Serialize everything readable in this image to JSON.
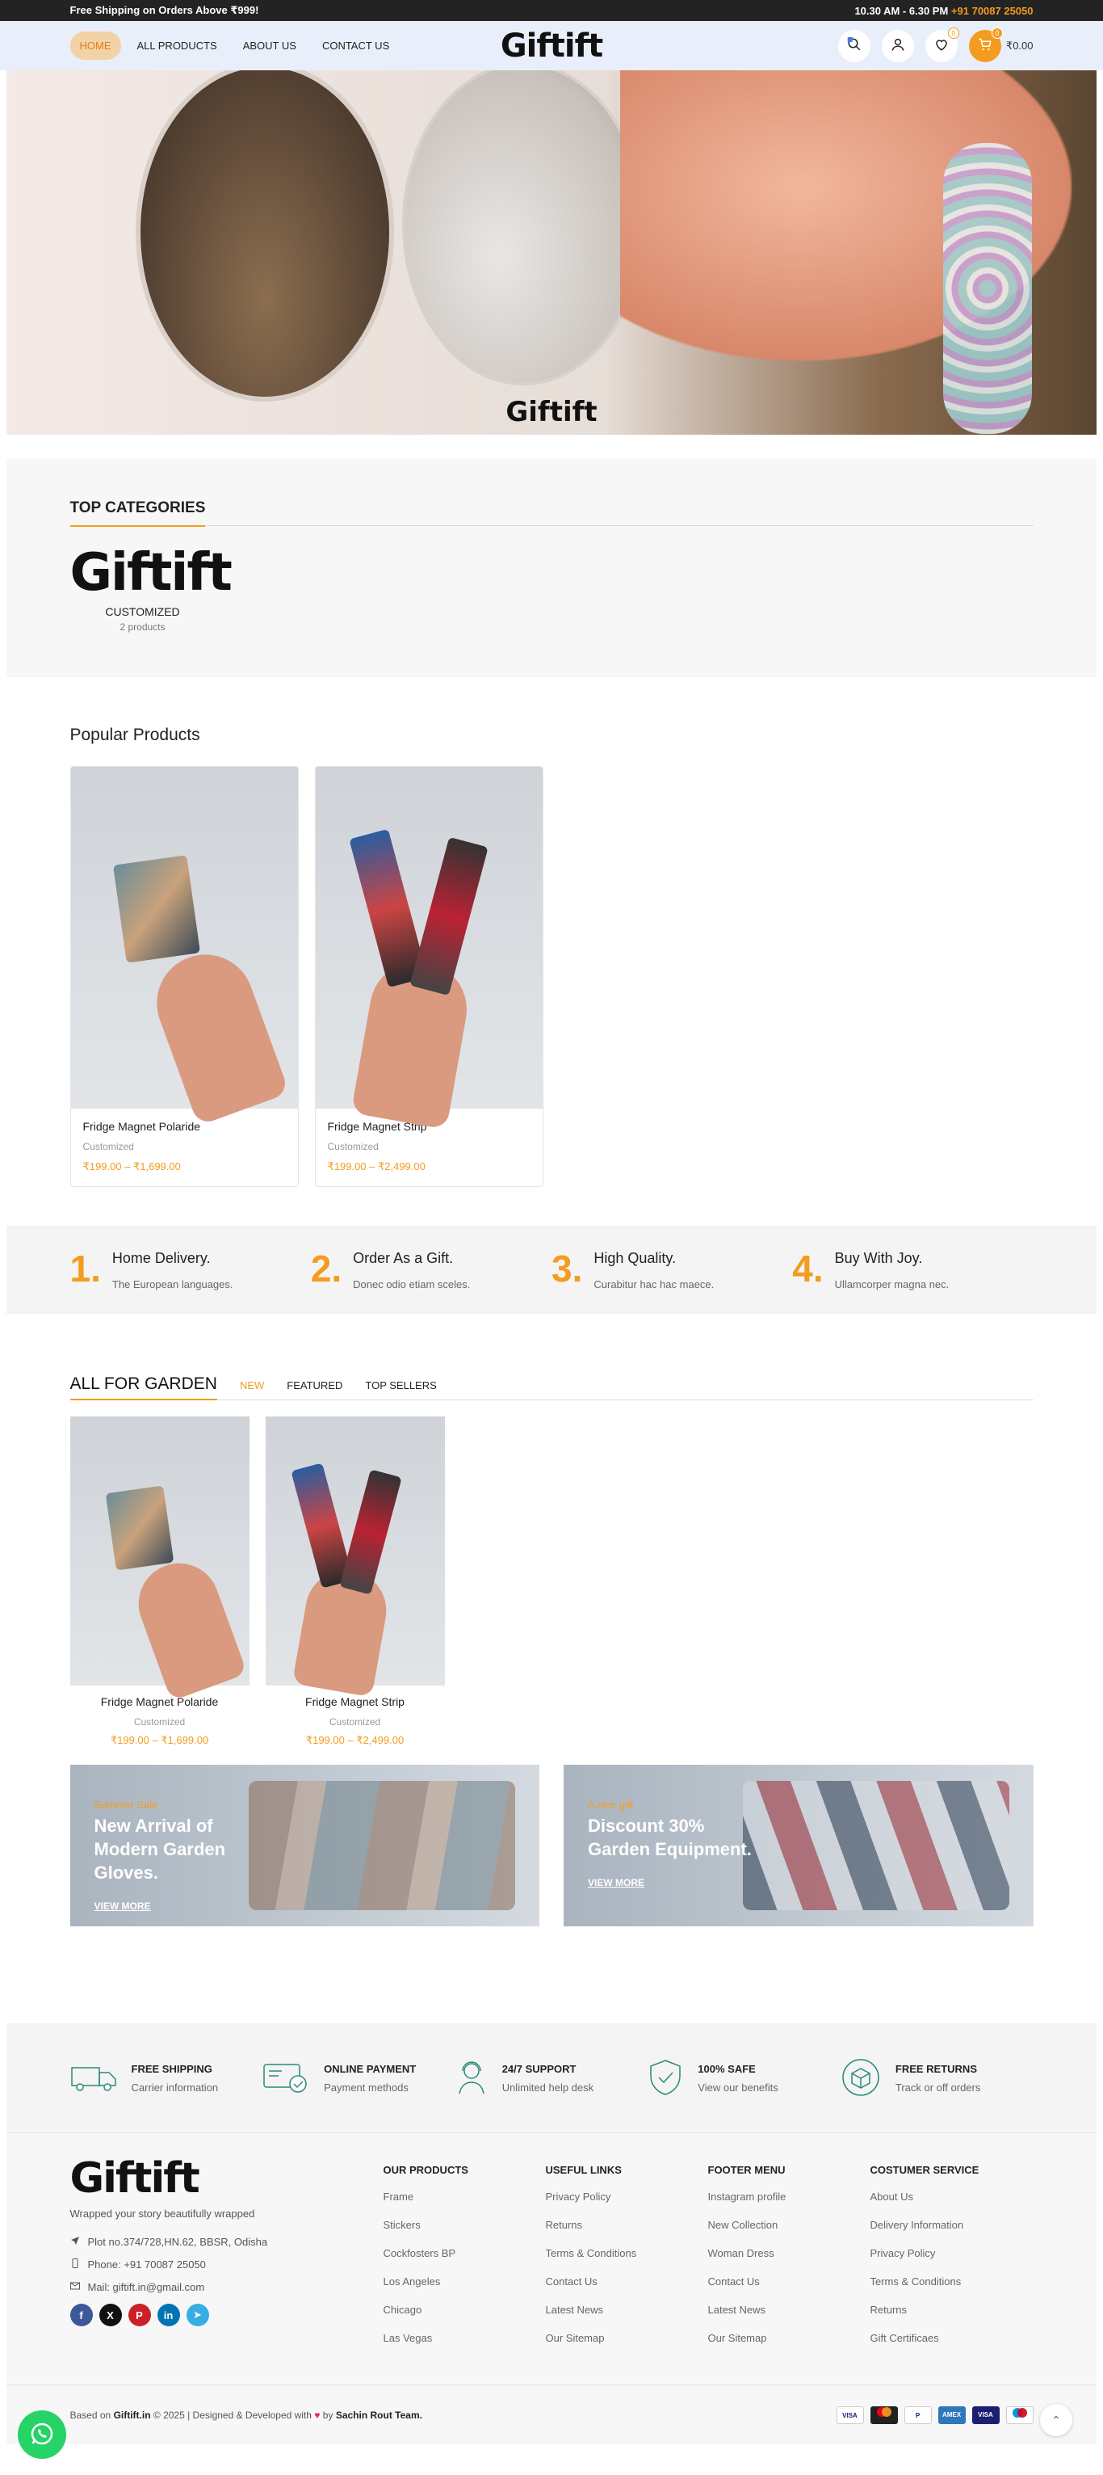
{
  "topbar": {
    "left": "Free Shipping on Orders Above ₹999!",
    "hours": "10.30 AM - 6.30 PM",
    "phone": "+91 70087 25050"
  },
  "header": {
    "nav": [
      {
        "label": "HOME",
        "active": true
      },
      {
        "label": "ALL PRODUCTS"
      },
      {
        "label": "ABOUT US"
      },
      {
        "label": "CONTACT US"
      }
    ],
    "logo": "Giftift",
    "wishlist_count": "0",
    "cart_count": "0",
    "cart_total": "₹0.00"
  },
  "hero": {
    "logo": "Giftift"
  },
  "top_categories": {
    "title": "TOP CATEGORIES",
    "items": [
      {
        "logo": "Giftift",
        "name": "CUSTOMIZED",
        "count": "2 products"
      }
    ]
  },
  "popular": {
    "title": "Popular Products",
    "products": [
      {
        "name": "Fridge Magnet Polaride",
        "category": "Customized",
        "price": "₹199.00 – ₹1,699.00"
      },
      {
        "name": "Fridge Magnet Strip",
        "category": "Customized",
        "price": "₹199.00 – ₹2,499.00"
      }
    ]
  },
  "features": [
    {
      "num": "1.",
      "title": "Home Delivery.",
      "desc": "The European languages."
    },
    {
      "num": "2.",
      "title": "Order As a Gift.",
      "desc": "Donec odio etiam sceles."
    },
    {
      "num": "3.",
      "title": "High Quality.",
      "desc": "Curabitur hac hac maece."
    },
    {
      "num": "4.",
      "title": "Buy With Joy.",
      "desc": "Ullamcorper magna nec."
    }
  ],
  "garden": {
    "title": "ALL FOR GARDEN",
    "tabs": [
      "NEW",
      "FEATURED",
      "TOP SELLERS"
    ],
    "products": [
      {
        "name": "Fridge Magnet Polaride",
        "category": "Customized",
        "price": "₹199.00 – ₹1,699.00"
      },
      {
        "name": "Fridge Magnet Strip",
        "category": "Customized",
        "price": "₹199.00 – ₹2,499.00"
      }
    ],
    "banners": [
      {
        "sub": "Summer Sale",
        "title": "New Arrival of Modern Garden Gloves.",
        "link": "VIEW MORE"
      },
      {
        "sub": "A nice gift",
        "title": "Discount 30% Garden Equipment.",
        "link": "VIEW MORE"
      }
    ]
  },
  "services": [
    {
      "icon": "truck-icon",
      "title": "FREE SHIPPING",
      "desc": "Carrier information"
    },
    {
      "icon": "payment-icon",
      "title": "ONLINE PAYMENT",
      "desc": "Payment methods"
    },
    {
      "icon": "support-icon",
      "title": "24/7 SUPPORT",
      "desc": "Unlimited help desk"
    },
    {
      "icon": "shield-icon",
      "title": "100% SAFE",
      "desc": "View our benefits"
    },
    {
      "icon": "box-return-icon",
      "title": "FREE RETURNS",
      "desc": "Track or off orders"
    }
  ],
  "footer": {
    "logo": "Giftift",
    "tagline": "Wrapped your story beautifully wrapped",
    "address": "Plot no.374/728,HN.62, BBSR, Odisha",
    "phone": "Phone: +91 70087 25050",
    "mail": "Mail: giftift.in@gmail.com",
    "columns": [
      {
        "title": "OUR PRODUCTS",
        "links": [
          "Frame",
          "Stickers",
          "Cockfosters BP",
          "Los Angeles",
          "Chicago",
          "Las Vegas"
        ]
      },
      {
        "title": "USEFUL LINKS",
        "links": [
          "Privacy Policy",
          "Returns",
          "Terms & Conditions",
          "Contact Us",
          "Latest News",
          "Our Sitemap"
        ]
      },
      {
        "title": "FOOTER MENU",
        "links": [
          "Instagram profile",
          "New Collection",
          "Woman Dress",
          "Contact Us",
          "Latest News",
          "Our Sitemap"
        ]
      },
      {
        "title": "COSTUMER SERVICE",
        "links": [
          "About Us",
          "Delivery Information",
          "Privacy Policy",
          "Terms & Conditions",
          "Returns",
          "Gift Certificaes"
        ]
      }
    ],
    "copyright_prefix": "Based on",
    "site": "Giftift.in",
    "copyright_mid": "2025 | Designed & Developed with",
    "copyright_by": "by",
    "team": "Sachin Rout Team."
  },
  "colors": {
    "accent": "#f39c1f",
    "topbar": "#232323",
    "header": "#e9eefb"
  }
}
